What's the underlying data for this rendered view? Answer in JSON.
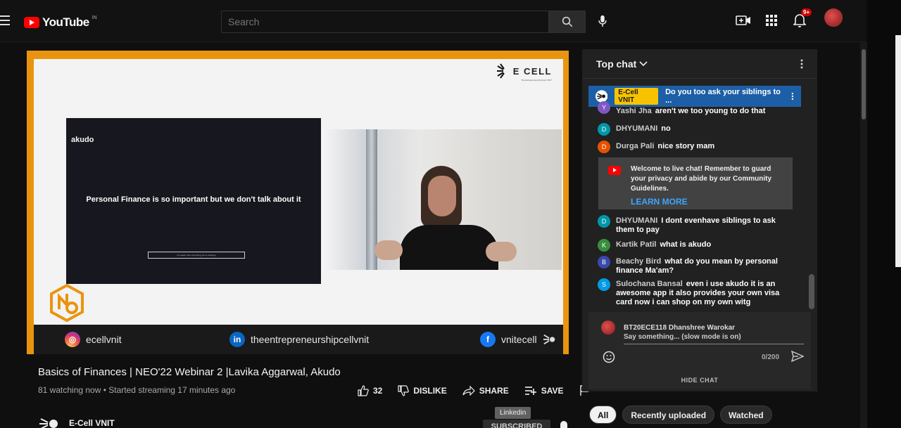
{
  "header": {
    "logo_text": "YouTube",
    "region": "IN",
    "search_placeholder": "Search",
    "notification_count": "9+"
  },
  "player": {
    "slide": {
      "brand_logo": "E CELL",
      "brand_tagline": "The Entrepreneurship Cell, VNIT",
      "akudo_label": "akudo",
      "headline": "Personal Finance is so important but we don't talk about it",
      "subline": "It's easier than everything you're studying",
      "event_logo": "NEO"
    },
    "socials": [
      {
        "handle": "ecellvnit",
        "icon": "instagram-icon"
      },
      {
        "handle": "theentrepreneurshipcellvnit",
        "icon": "linkedin-icon"
      },
      {
        "handle": "vnitecell",
        "icon": "facebook-icon"
      }
    ]
  },
  "video": {
    "title": "Basics of Finances | NEO'22 Webinar 2 |Lavika Aggarwal, Akudo",
    "meta": "81 watching now • Started streaming 17 minutes ago",
    "likes": "32",
    "dislike_label": "DISLIKE",
    "share_label": "SHARE",
    "save_label": "SAVE",
    "tooltip": "Linkedin",
    "channel_name": "E-Cell VNIT",
    "subscribe_label": "SUBSCRIBED"
  },
  "chat": {
    "header": "Top chat",
    "pinned": {
      "author": "E-Cell VNIT",
      "text": "Do you too ask your siblings to ..."
    },
    "messages": [
      {
        "author": "Yashi Jha",
        "text": "aren't we too young to do that",
        "initial": "Y",
        "color": "#7e57c2"
      },
      {
        "author": "DHYUMANI",
        "text": "no",
        "initial": "D",
        "color": "#0097a7"
      },
      {
        "author": "Durga Pali",
        "text": "nice story mam",
        "initial": "D",
        "color": "#e65100"
      },
      {
        "author": "DHYUMANI",
        "text": "I dont evenhave siblings to ask them to pay",
        "initial": "D",
        "color": "#0097a7"
      },
      {
        "author": "Kartik Patil",
        "text": "what is akudo",
        "initial": "K",
        "color": "#388e3c"
      },
      {
        "author": "Beachy Bird",
        "text": "what do you mean by personal finance Ma'am?",
        "initial": "B",
        "color": "#3949ab"
      },
      {
        "author": "Sulochana Bansal",
        "text": "even i use akudo it is an awesome app it also provides your own visa card now i can shop on my own witg",
        "initial": "S",
        "color": "#039be5"
      }
    ],
    "welcome": "Welcome to live chat! Remember to guard your privacy and abide by our Community Guidelines.",
    "learn_more": "LEARN MORE",
    "current_user": "BT20ECE118 Dhanshree Warokar",
    "input_placeholder": "Say something... (slow mode is on)",
    "char_count": "0/200",
    "hide_chat": "HIDE CHAT"
  },
  "chips": [
    "All",
    "Recently uploaded",
    "Watched"
  ],
  "colors": {
    "accent_red": "#ff0000",
    "player_border": "#e9940f",
    "link_blue": "#3ea6ff",
    "pinned_bg": "#1d5fa6"
  }
}
